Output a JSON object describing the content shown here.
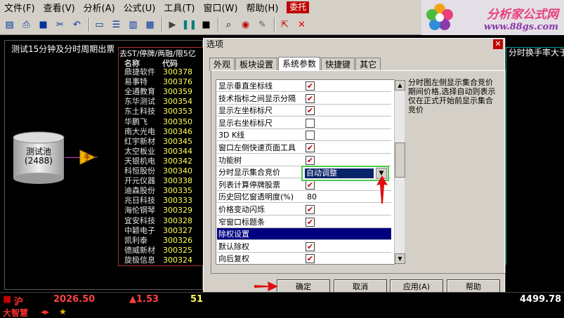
{
  "menu": [
    "文件(F)",
    "查看(V)",
    "分析(A)",
    "公式(U)",
    "工具(T)",
    "窗口(W)",
    "帮助(H)"
  ],
  "menu_entrust": "委托",
  "logo": {
    "title": "分析家公式网",
    "url": "www.88gs.com"
  },
  "left_window": {
    "title": "测试15分钟及分时周期出票",
    "pool_label": "测试池",
    "pool_count": "(2488)",
    "arrow_label": "手"
  },
  "list": {
    "title": "去ST/停牌/两融/限5亿",
    "header": {
      "name": "名称",
      "code": "代码"
    },
    "rows": [
      {
        "name": "鼎捷软件",
        "code": "300378"
      },
      {
        "name": "易事特",
        "code": "300376"
      },
      {
        "name": "全通教育",
        "code": "300359"
      },
      {
        "name": "东华测试",
        "code": "300354"
      },
      {
        "name": "东土科技",
        "code": "300353"
      },
      {
        "name": "华鹏飞",
        "code": "300350"
      },
      {
        "name": "南大光电",
        "code": "300346"
      },
      {
        "name": "红宇新材",
        "code": "300345"
      },
      {
        "name": "太空板业",
        "code": "300344"
      },
      {
        "name": "天银机电",
        "code": "300342"
      },
      {
        "name": "科恒股份",
        "code": "300340"
      },
      {
        "name": "开元仪器",
        "code": "300338"
      },
      {
        "name": "迪森股份",
        "code": "300335"
      },
      {
        "name": "兆日科技",
        "code": "300333"
      },
      {
        "name": "海伦钢琴",
        "code": "300329"
      },
      {
        "name": "宜安科技",
        "code": "300328"
      },
      {
        "name": "中颖电子",
        "code": "300327"
      },
      {
        "name": "凯利泰",
        "code": "300326"
      },
      {
        "name": "德威新材",
        "code": "300325"
      },
      {
        "name": "旋极信息",
        "code": "300324"
      }
    ]
  },
  "right_window": {
    "title": "分时换手率大于"
  },
  "dialog": {
    "title": "选项",
    "close": "✕",
    "tabs": [
      "外观",
      "板块设置",
      "系统参数",
      "快捷键",
      "其它"
    ],
    "options": [
      {
        "label": "显示垂直坐标线",
        "check": "✔"
      },
      {
        "label": "技术指标之间显示分隔",
        "check": "✔"
      },
      {
        "label": "显示左坐标标尺",
        "check": "✔"
      },
      {
        "label": "显示右坐标标尺",
        "check": ""
      },
      {
        "label": "3D K线",
        "check": ""
      },
      {
        "label": "窗口左侧快速页面工具",
        "check": "✔"
      },
      {
        "label": "功能树",
        "check": "✔"
      },
      {
        "label": "分时显示集合竞价",
        "check": ""
      },
      {
        "label": "列表计算停牌股票",
        "check": "✔"
      },
      {
        "label": "历史回忆窗透明度(%)",
        "value": "80"
      },
      {
        "label": "价格变动闪烁",
        "check": "✔"
      },
      {
        "label": "窄窗口标题条",
        "check": "✔"
      },
      {
        "label": "除权设置",
        "section": true
      },
      {
        "label": "默认除权",
        "check": "✔"
      },
      {
        "label": "向后复权",
        "check": "✔"
      }
    ],
    "combo_value": "自动调整",
    "description": "分时图左侧显示集合竞价期间价格,选择自动则表示仅在正式开始前显示集合竞价",
    "buttons": {
      "ok": "确定",
      "cancel": "取消",
      "apply": "应用(A)",
      "help": "帮助"
    }
  },
  "status": {
    "market": "沪",
    "index": "2026.50",
    "change": "▲1.53",
    "vol": "51",
    "right_val": "4499.78"
  },
  "bottom": {
    "label": "大智慧"
  }
}
